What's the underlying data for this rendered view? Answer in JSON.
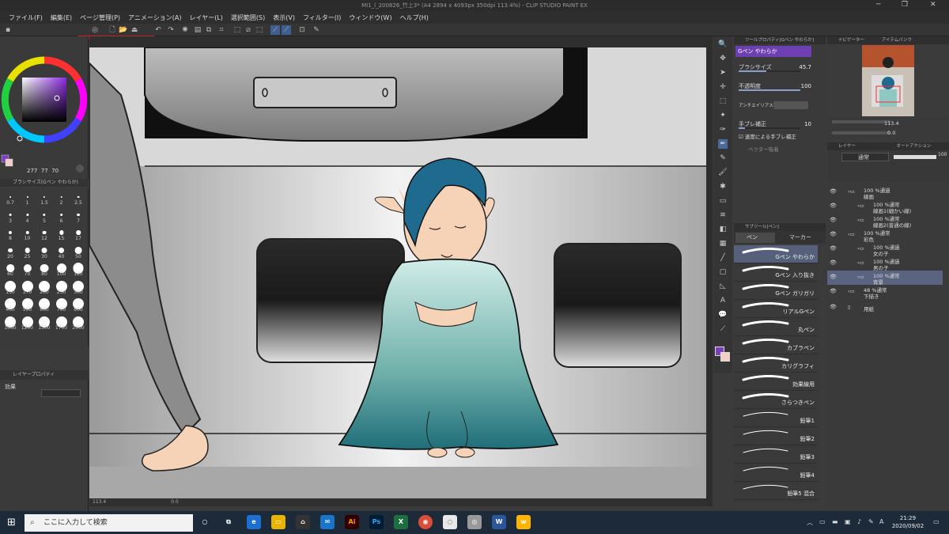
{
  "window": {
    "title": "MI1_l_200826_竹上3* (A4 2894 x 4093px 350dpi 113.4%) - CLIP STUDIO PAINT EX"
  },
  "menu": [
    "ファイル(F)",
    "編集(E)",
    "ページ管理(P)",
    "アニメーション(A)",
    "レイヤー(L)",
    "選択範囲(S)",
    "表示(V)",
    "フィルター(I)",
    "ウィンドウ(W)",
    "ヘルプ(H)"
  ],
  "colors": {
    "main": "#7b3fbf",
    "sub": "#f2d0c8",
    "accent": "#3f5f8f"
  },
  "color_panel": {
    "h": "277",
    "s": "77",
    "v": "70"
  },
  "brush_size_panel": {
    "title": "ブラシサイズ(Gペン やわらか)",
    "sizes": [
      "0.7",
      "1",
      "1.5",
      "2",
      "2.5",
      "3",
      "4",
      "5",
      "6",
      "7",
      "8",
      "10",
      "12",
      "15",
      "17",
      "20",
      "25",
      "30",
      "40",
      "50",
      "60",
      "70",
      "80",
      "100",
      "120",
      "150",
      "170",
      "200",
      "250",
      "300",
      "400",
      "500",
      "600",
      "700",
      "800",
      "1000",
      "1200",
      "1500",
      "1700",
      "2000"
    ]
  },
  "layer_property": {
    "title": "レイヤープロパティ",
    "effect_label": "効果"
  },
  "tool_property": {
    "title": "ツールプロパティ[Gペン やわらか]",
    "tool_name": "Gペン やわらか",
    "brush_size_label": "ブラシサイズ",
    "brush_size_value": "45.7",
    "brush_size_fraction": 0.45,
    "opacity_label": "不透明度",
    "opacity_value": "100",
    "opacity_fraction": 1.0,
    "antialias_label": "アンチエイリアス",
    "stabilization_label": "手ブレ補正",
    "stabilization_value": "10",
    "stabilization_fraction": 0.1,
    "speed_stabilization_label": "速度による手ブレ補正",
    "vector_snap_label": "ベクター吸着"
  },
  "subtool": {
    "title": "サブツール[ペン]",
    "tabs": [
      "ペン",
      "マーカー"
    ],
    "items": [
      "Gペン やわらか",
      "Gペン 入り抜き",
      "Gペン ガリガリ",
      "リアルGペン",
      "丸ペン",
      "カブラペン",
      "カリグラフィ",
      "効果線用",
      "さらつきペン",
      "鉛筆1",
      "鉛筆2",
      "鉛筆3",
      "鉛筆4",
      "鉛筆5 混合"
    ]
  },
  "navigator": {
    "title": "ナビゲーター",
    "tab2": "アイテムバンク",
    "zoom": "113.4",
    "angle": "0.0"
  },
  "layers": {
    "title": "レイヤー",
    "tab2": "オートアクション",
    "blend_mode": "通常",
    "opacity": "100",
    "items": [
      {
        "line1": "100 %通過",
        "line2": "線画",
        "indent": 0,
        "folder": true
      },
      {
        "line1": "100 %通常",
        "line2": "線画1(細かい線)",
        "indent": 1,
        "folder": true
      },
      {
        "line1": "100 %通常",
        "line2": "線画2(普通の線)",
        "indent": 1,
        "folder": true
      },
      {
        "line1": "100 %通常",
        "line2": "彩色",
        "indent": 0,
        "folder": true
      },
      {
        "line1": "100 %通過",
        "line2": "女の子",
        "indent": 1,
        "folder": true
      },
      {
        "line1": "100 %通過",
        "line2": "男の子",
        "indent": 1,
        "folder": true
      },
      {
        "line1": "100 %通常",
        "line2": "背景",
        "indent": 1,
        "folder": true,
        "selected": true
      },
      {
        "line1": "48 %通常",
        "line2": "下描き",
        "indent": 0,
        "folder": true
      },
      {
        "line1": "",
        "line2": "用紙",
        "indent": 0,
        "folder": false
      }
    ]
  },
  "canvas_status": {
    "zoom": "113.4",
    "angle": "0.0"
  },
  "taskbar": {
    "search_placeholder": "ここに入力して検索",
    "time": "21:29",
    "date": "2020/09/02",
    "ime": "A"
  }
}
